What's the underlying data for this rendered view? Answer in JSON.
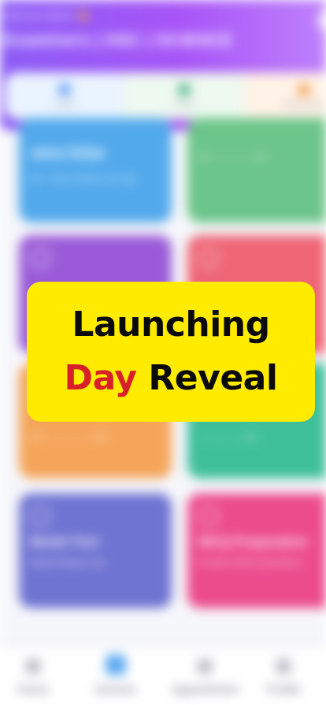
{
  "header": {
    "greeting": "Welcome Back! 👋",
    "title": "Examiners | HSC | SCIENCE"
  },
  "quick_actions": [
    {
      "label": "Library",
      "icon": "book-icon"
    },
    {
      "label": "Profile",
      "icon": "user-icon"
    },
    {
      "label": "Achievement",
      "icon": "trophy-icon"
    }
  ],
  "cards": [
    {
      "title": "অধ্যায় ভিত্তিক",
      "subtitle": "বই - অধ্যায় ভিত্তিক প্রশ্ন সমূহ",
      "icon": "book-icon"
    },
    {
      "title": "",
      "subtitle": "বই - ---- ---- - প্রশ্ন",
      "icon": "book-icon"
    },
    {
      "title": "",
      "subtitle": "",
      "icon": "pencil-icon"
    },
    {
      "title": "",
      "subtitle": "",
      "icon": "gear-icon"
    },
    {
      "title": "",
      "subtitle": "বই - ---- ---- ---- প্রশ্ন",
      "icon": "clipboard-icon"
    },
    {
      "title": "",
      "subtitle": "---- ---- ---- প্রশ্ন",
      "icon": "clipboard-icon"
    },
    {
      "title": "Model Test",
      "subtitle": "Attend Model Test",
      "icon": "chat-icon"
    },
    {
      "title": "MCQ Preparation",
      "subtitle": "Practice MCQ Questions",
      "icon": "target-icon"
    }
  ],
  "banner": {
    "line1": "Launching",
    "line2_accent": "Day",
    "line2_rest": "Reveal"
  },
  "bottom_nav": {
    "home": "Home",
    "doctors": "Doctors",
    "appointment": "Appointment",
    "profile": "Profile"
  },
  "colors": {
    "banner_bg": "#ffeb00",
    "accent_red": "#d8202a",
    "header_purple": "#8b5cf6"
  }
}
